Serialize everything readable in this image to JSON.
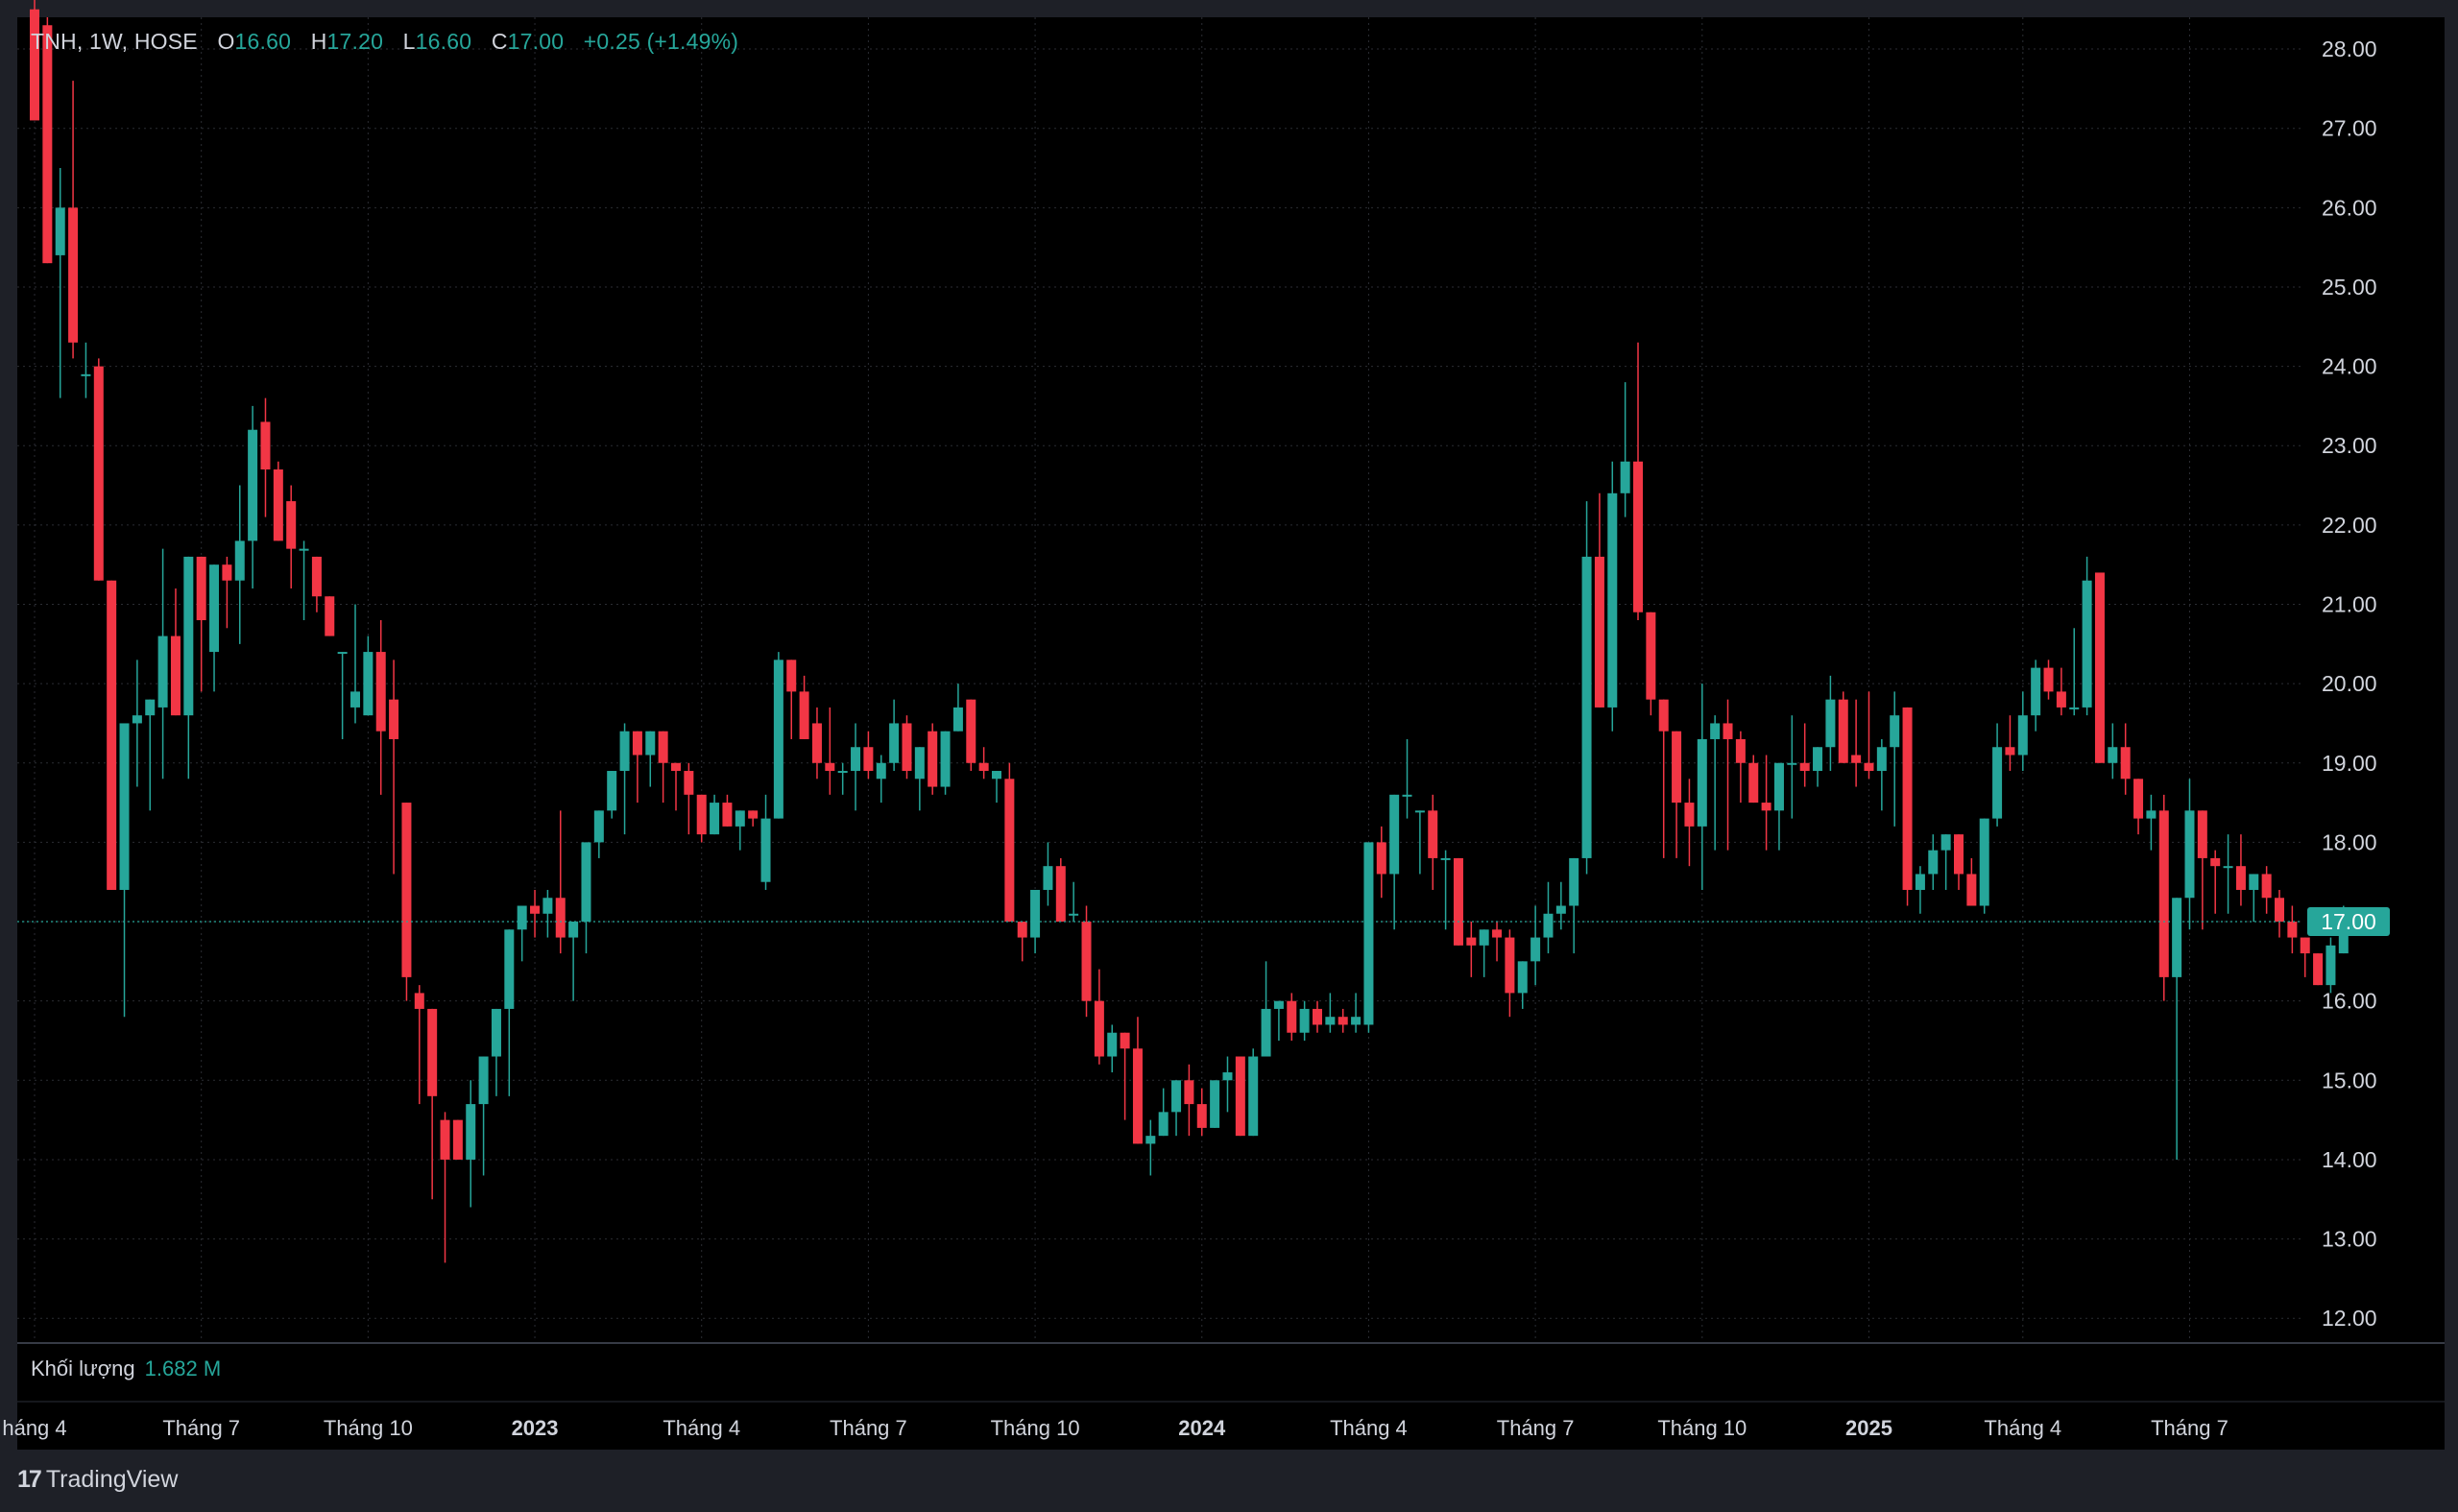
{
  "legend": {
    "symbol": "TNH, 1W, HOSE",
    "open_label": "O",
    "open": "16.60",
    "high_label": "H",
    "high": "17.20",
    "low_label": "L",
    "low": "16.60",
    "close_label": "C",
    "close": "17.00",
    "change": "+0.25 (+1.49%)"
  },
  "volume": {
    "label": "Khối lượng",
    "value": "1.682 M"
  },
  "brand": {
    "name": "TradingView",
    "logo_glyph": "17"
  },
  "colors": {
    "up": "#26a69a",
    "down": "#f23645",
    "background": "#000000",
    "frame": "#1e2027",
    "grid": "#2b2d33",
    "text": "#d1d4dc"
  },
  "chart_data": {
    "type": "candlestick",
    "interval": "1W",
    "ylim": [
      11.7,
      28.4
    ],
    "y_ticks": [
      "28.00",
      "27.00",
      "26.00",
      "25.00",
      "24.00",
      "23.00",
      "22.00",
      "21.00",
      "20.00",
      "19.00",
      "18.00",
      "17.00",
      "16.00",
      "15.00",
      "14.00",
      "13.00",
      "12.00"
    ],
    "last_price": "17.00",
    "x_ticks": [
      {
        "label": "háng 4",
        "bar": 0,
        "bold": false
      },
      {
        "label": "Tháng 7",
        "bar": 13,
        "bold": false
      },
      {
        "label": "Tháng 10",
        "bar": 26,
        "bold": false
      },
      {
        "label": "2023",
        "bar": 39,
        "bold": true
      },
      {
        "label": "Tháng 4",
        "bar": 52,
        "bold": false
      },
      {
        "label": "Tháng 7",
        "bar": 65,
        "bold": false
      },
      {
        "label": "Tháng 10",
        "bar": 78,
        "bold": false
      },
      {
        "label": "2024",
        "bar": 91,
        "bold": true
      },
      {
        "label": "Tháng 4",
        "bar": 104,
        "bold": false
      },
      {
        "label": "Tháng 7",
        "bar": 117,
        "bold": false
      },
      {
        "label": "Tháng 10",
        "bar": 130,
        "bold": false
      },
      {
        "label": "2025",
        "bar": 143,
        "bold": true
      },
      {
        "label": "Tháng 4",
        "bar": 155,
        "bold": false
      },
      {
        "label": "Tháng 7",
        "bar": 168,
        "bold": false
      }
    ],
    "candles": [
      [
        28.5,
        28.8,
        27.1,
        27.1
      ],
      [
        28.3,
        28.4,
        25.3,
        25.3
      ],
      [
        25.4,
        26.5,
        23.6,
        26.0
      ],
      [
        26.0,
        27.6,
        24.1,
        24.3
      ],
      [
        23.9,
        24.3,
        23.6,
        23.9
      ],
      [
        24.0,
        24.1,
        21.4,
        21.3
      ],
      [
        21.3,
        21.3,
        17.4,
        17.4
      ],
      [
        17.4,
        17.4,
        15.8,
        19.5
      ],
      [
        19.5,
        20.3,
        18.7,
        19.6
      ],
      [
        19.6,
        19.8,
        18.4,
        19.8
      ],
      [
        19.7,
        21.7,
        18.8,
        20.6
      ],
      [
        20.6,
        21.2,
        19.6,
        19.6
      ],
      [
        19.6,
        21.2,
        18.8,
        21.6
      ],
      [
        21.6,
        21.6,
        19.9,
        20.8
      ],
      [
        20.4,
        21.2,
        19.9,
        21.5
      ],
      [
        21.5,
        21.6,
        20.7,
        21.3
      ],
      [
        21.3,
        22.5,
        20.5,
        21.8
      ],
      [
        21.8,
        23.5,
        21.2,
        23.2
      ],
      [
        23.3,
        23.6,
        22.1,
        22.7
      ],
      [
        22.7,
        22.8,
        21.9,
        21.8
      ],
      [
        22.3,
        22.5,
        21.2,
        21.7
      ],
      [
        21.7,
        21.8,
        20.8,
        21.7
      ],
      [
        21.6,
        21.6,
        20.9,
        21.1
      ],
      [
        21.1,
        21.1,
        20.6,
        20.6
      ],
      [
        20.4,
        20.4,
        19.3,
        20.4
      ],
      [
        19.7,
        21.0,
        19.5,
        19.9
      ],
      [
        19.6,
        20.6,
        19.6,
        20.4
      ],
      [
        20.4,
        20.8,
        18.6,
        19.4
      ],
      [
        19.8,
        20.3,
        17.6,
        19.3
      ],
      [
        18.5,
        18.5,
        16.0,
        16.3
      ],
      [
        16.1,
        16.2,
        14.7,
        15.9
      ],
      [
        15.9,
        15.9,
        13.5,
        14.8
      ],
      [
        14.5,
        14.6,
        12.7,
        14.0
      ],
      [
        14.5,
        14.5,
        14.0,
        14.0
      ],
      [
        14.0,
        15.0,
        13.4,
        14.7
      ],
      [
        14.7,
        15.3,
        13.8,
        15.3
      ],
      [
        15.3,
        15.4,
        14.8,
        15.9
      ],
      [
        15.9,
        16.5,
        14.8,
        16.9
      ],
      [
        16.9,
        17.0,
        16.5,
        17.2
      ],
      [
        17.2,
        17.4,
        16.8,
        17.1
      ],
      [
        17.1,
        17.4,
        16.8,
        17.3
      ],
      [
        17.3,
        18.4,
        16.6,
        16.8
      ],
      [
        16.8,
        16.5,
        16.0,
        17.0
      ],
      [
        17.0,
        17.6,
        16.6,
        18.0
      ],
      [
        18.0,
        18.0,
        17.8,
        18.4
      ],
      [
        18.4,
        18.6,
        18.3,
        18.9
      ],
      [
        18.9,
        19.5,
        18.1,
        19.4
      ],
      [
        19.4,
        19.4,
        18.5,
        19.1
      ],
      [
        19.1,
        19.4,
        18.7,
        19.4
      ],
      [
        19.4,
        19.0,
        18.5,
        19.0
      ],
      [
        19.0,
        19.0,
        18.4,
        18.9
      ],
      [
        18.9,
        19.0,
        18.1,
        18.6
      ],
      [
        18.6,
        18.6,
        18.0,
        18.1
      ],
      [
        18.1,
        18.6,
        18.1,
        18.5
      ],
      [
        18.5,
        18.6,
        18.2,
        18.2
      ],
      [
        18.2,
        18.4,
        17.9,
        18.4
      ],
      [
        18.4,
        18.4,
        18.2,
        18.3
      ],
      [
        17.5,
        18.6,
        17.4,
        18.3
      ],
      [
        18.3,
        20.4,
        18.3,
        20.3
      ],
      [
        20.3,
        20.3,
        19.3,
        19.9
      ],
      [
        19.9,
        20.1,
        19.3,
        19.3
      ],
      [
        19.5,
        19.7,
        18.8,
        19.0
      ],
      [
        19.0,
        19.7,
        18.6,
        18.9
      ],
      [
        18.9,
        19.0,
        18.6,
        18.9
      ],
      [
        18.9,
        19.5,
        18.4,
        19.2
      ],
      [
        19.2,
        19.4,
        18.8,
        18.9
      ],
      [
        18.8,
        19.1,
        18.5,
        19.0
      ],
      [
        19.0,
        19.8,
        18.9,
        19.5
      ],
      [
        19.5,
        19.6,
        18.8,
        18.9
      ],
      [
        18.8,
        19.1,
        18.4,
        19.2
      ],
      [
        19.4,
        19.5,
        18.6,
        18.7
      ],
      [
        18.7,
        19.4,
        18.6,
        19.4
      ],
      [
        19.4,
        20.0,
        19.4,
        19.7
      ],
      [
        19.8,
        19.8,
        18.9,
        19.0
      ],
      [
        19.0,
        19.2,
        18.8,
        18.9
      ],
      [
        18.8,
        18.8,
        18.5,
        18.9
      ],
      [
        18.8,
        19.0,
        17.0,
        17.0
      ],
      [
        17.0,
        16.9,
        16.5,
        16.8
      ],
      [
        16.8,
        16.8,
        16.6,
        17.4
      ],
      [
        17.4,
        18.0,
        17.2,
        17.7
      ],
      [
        17.7,
        17.8,
        17.0,
        17.0
      ],
      [
        17.1,
        17.5,
        17.0,
        17.1
      ],
      [
        17.0,
        17.2,
        15.8,
        16.0
      ],
      [
        16.0,
        16.4,
        15.2,
        15.3
      ],
      [
        15.3,
        15.7,
        15.1,
        15.6
      ],
      [
        15.6,
        15.6,
        14.5,
        15.4
      ],
      [
        15.4,
        15.8,
        14.8,
        14.2
      ],
      [
        14.2,
        14.5,
        13.8,
        14.3
      ],
      [
        14.3,
        14.9,
        14.3,
        14.6
      ],
      [
        14.6,
        14.8,
        14.3,
        15.0
      ],
      [
        15.0,
        15.2,
        14.3,
        14.7
      ],
      [
        14.7,
        14.9,
        14.3,
        14.4
      ],
      [
        14.4,
        15.0,
        14.4,
        15.0
      ],
      [
        15.0,
        15.3,
        14.6,
        15.1
      ],
      [
        15.3,
        15.2,
        14.3,
        14.3
      ],
      [
        14.3,
        15.4,
        14.3,
        15.3
      ],
      [
        15.3,
        16.5,
        15.3,
        15.9
      ],
      [
        15.9,
        16.0,
        15.5,
        16.0
      ],
      [
        16.0,
        16.1,
        15.5,
        15.6
      ],
      [
        15.6,
        16.0,
        15.5,
        15.9
      ],
      [
        15.9,
        16.0,
        15.6,
        15.7
      ],
      [
        15.7,
        16.1,
        15.6,
        15.8
      ],
      [
        15.8,
        15.9,
        15.6,
        15.7
      ],
      [
        15.7,
        16.1,
        15.6,
        15.8
      ],
      [
        15.7,
        18.0,
        15.6,
        18.0
      ],
      [
        18.0,
        18.2,
        17.3,
        17.6
      ],
      [
        17.6,
        18.6,
        16.9,
        18.6
      ],
      [
        18.6,
        19.3,
        18.3,
        18.6
      ],
      [
        18.4,
        18.4,
        17.6,
        18.4
      ],
      [
        18.4,
        18.6,
        17.4,
        17.8
      ],
      [
        17.8,
        17.9,
        16.9,
        17.8
      ],
      [
        17.8,
        17.8,
        17.0,
        16.7
      ],
      [
        16.8,
        17.0,
        16.3,
        16.7
      ],
      [
        16.7,
        16.9,
        16.3,
        16.9
      ],
      [
        16.9,
        17.0,
        16.5,
        16.8
      ],
      [
        16.8,
        16.9,
        15.8,
        16.1
      ],
      [
        16.1,
        16.4,
        15.9,
        16.5
      ],
      [
        16.5,
        17.2,
        16.2,
        16.8
      ],
      [
        16.8,
        17.5,
        16.6,
        17.1
      ],
      [
        17.1,
        17.5,
        16.9,
        17.2
      ],
      [
        17.2,
        17.2,
        16.6,
        17.8
      ],
      [
        17.8,
        22.3,
        17.6,
        21.6
      ],
      [
        21.6,
        22.4,
        19.7,
        19.7
      ],
      [
        19.7,
        22.8,
        19.4,
        22.4
      ],
      [
        22.4,
        23.8,
        22.1,
        22.8
      ],
      [
        22.8,
        24.3,
        20.8,
        20.9
      ],
      [
        20.9,
        20.9,
        19.6,
        19.8
      ],
      [
        19.8,
        19.8,
        17.8,
        19.4
      ],
      [
        19.4,
        19.0,
        17.8,
        18.5
      ],
      [
        18.5,
        18.8,
        17.7,
        18.2
      ],
      [
        18.2,
        20.0,
        17.4,
        19.3
      ],
      [
        19.3,
        19.6,
        17.9,
        19.5
      ],
      [
        19.5,
        19.8,
        17.9,
        19.3
      ],
      [
        19.3,
        19.4,
        18.5,
        19.0
      ],
      [
        19.0,
        19.1,
        18.6,
        18.5
      ],
      [
        18.5,
        19.1,
        17.9,
        18.4
      ],
      [
        18.4,
        19.0,
        17.9,
        19.0
      ],
      [
        19.0,
        19.6,
        18.3,
        19.0
      ],
      [
        19.0,
        19.5,
        18.7,
        18.9
      ],
      [
        18.9,
        19.2,
        18.7,
        19.2
      ],
      [
        19.2,
        20.1,
        18.9,
        19.8
      ],
      [
        19.8,
        19.9,
        19.1,
        19.0
      ],
      [
        19.1,
        19.8,
        18.7,
        19.0
      ],
      [
        19.0,
        19.9,
        18.8,
        18.9
      ],
      [
        18.9,
        19.3,
        18.4,
        19.2
      ],
      [
        19.2,
        19.9,
        18.2,
        19.6
      ],
      [
        19.7,
        19.7,
        17.2,
        17.4
      ],
      [
        17.4,
        17.7,
        17.1,
        17.6
      ],
      [
        17.6,
        18.1,
        17.4,
        17.9
      ],
      [
        17.9,
        18.1,
        17.4,
        18.1
      ],
      [
        18.1,
        18.1,
        17.4,
        17.6
      ],
      [
        17.6,
        17.8,
        17.2,
        17.2
      ],
      [
        17.2,
        18.3,
        17.1,
        18.3
      ],
      [
        18.3,
        19.5,
        18.2,
        19.2
      ],
      [
        19.2,
        19.6,
        18.9,
        19.1
      ],
      [
        19.1,
        19.9,
        18.9,
        19.6
      ],
      [
        19.6,
        20.3,
        19.4,
        20.2
      ],
      [
        20.2,
        20.3,
        19.8,
        19.9
      ],
      [
        19.9,
        20.2,
        19.6,
        19.7
      ],
      [
        19.7,
        20.7,
        19.6,
        19.7
      ],
      [
        19.7,
        21.6,
        19.6,
        21.3
      ],
      [
        21.4,
        21.4,
        19.1,
        19.0
      ],
      [
        19.0,
        19.5,
        18.8,
        19.2
      ],
      [
        19.2,
        19.5,
        18.6,
        18.8
      ],
      [
        18.8,
        18.8,
        18.1,
        18.3
      ],
      [
        18.3,
        18.6,
        17.9,
        18.4
      ],
      [
        18.4,
        18.6,
        16.0,
        16.3
      ],
      [
        16.3,
        16.3,
        14.0,
        17.3
      ],
      [
        17.3,
        18.8,
        16.9,
        18.4
      ],
      [
        18.4,
        18.2,
        16.9,
        17.8
      ],
      [
        17.8,
        17.9,
        17.1,
        17.7
      ],
      [
        17.7,
        18.1,
        17.1,
        17.7
      ],
      [
        17.7,
        18.1,
        17.2,
        17.4
      ],
      [
        17.4,
        17.6,
        17.0,
        17.6
      ],
      [
        17.6,
        17.7,
        17.1,
        17.3
      ],
      [
        17.3,
        17.4,
        16.8,
        17.0
      ],
      [
        17.0,
        17.2,
        16.6,
        16.8
      ],
      [
        16.8,
        16.8,
        16.3,
        16.6
      ],
      [
        16.6,
        16.6,
        16.3,
        16.2
      ],
      [
        16.2,
        16.8,
        16.1,
        16.7
      ],
      [
        16.6,
        17.2,
        16.6,
        17.0
      ]
    ]
  }
}
